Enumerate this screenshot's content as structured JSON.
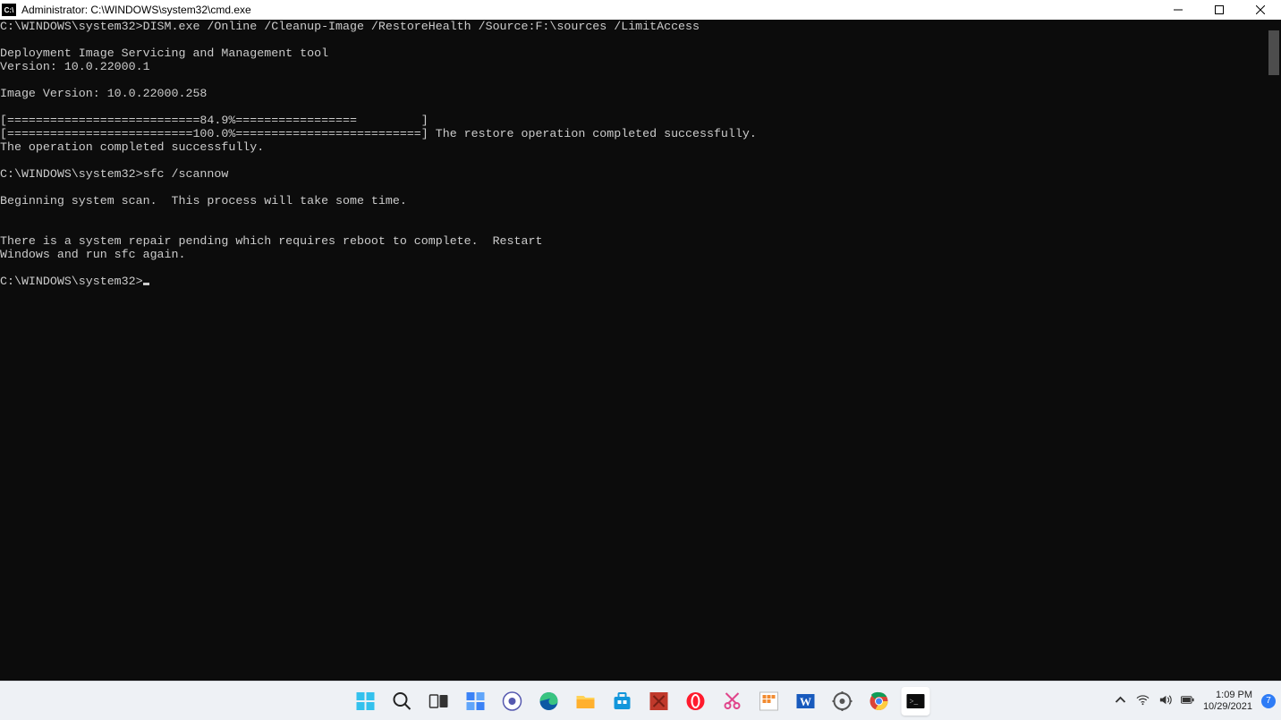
{
  "window": {
    "title": "Administrator: C:\\WINDOWS\\system32\\cmd.exe",
    "appicon_text": "C:\\"
  },
  "terminal": {
    "lines": [
      "C:\\WINDOWS\\system32>DISM.exe /Online /Cleanup-Image /RestoreHealth /Source:F:\\sources /LimitAccess",
      "",
      "Deployment Image Servicing and Management tool",
      "Version: 10.0.22000.1",
      "",
      "Image Version: 10.0.22000.258",
      "",
      "[===========================84.9%=================         ]",
      "[==========================100.0%==========================] The restore operation completed successfully.",
      "The operation completed successfully.",
      "",
      "C:\\WINDOWS\\system32>sfc /scannow",
      "",
      "Beginning system scan.  This process will take some time.",
      "",
      "",
      "There is a system repair pending which requires reboot to complete.  Restart",
      "Windows and run sfc again.",
      "",
      "C:\\WINDOWS\\system32>"
    ]
  },
  "taskbar": {
    "items": [
      {
        "name": "start",
        "label": "Start"
      },
      {
        "name": "search",
        "label": "Search"
      },
      {
        "name": "taskview",
        "label": "Task View"
      },
      {
        "name": "widgets",
        "label": "Widgets"
      },
      {
        "name": "chat",
        "label": "Chat"
      },
      {
        "name": "edge",
        "label": "Edge"
      },
      {
        "name": "explorer",
        "label": "File Explorer"
      },
      {
        "name": "store",
        "label": "Microsoft Store"
      },
      {
        "name": "app-red",
        "label": "App"
      },
      {
        "name": "opera",
        "label": "Opera"
      },
      {
        "name": "snip",
        "label": "Snip & Sketch"
      },
      {
        "name": "app-grid",
        "label": "App"
      },
      {
        "name": "word",
        "label": "Word"
      },
      {
        "name": "settings",
        "label": "Settings"
      },
      {
        "name": "chrome",
        "label": "Chrome"
      },
      {
        "name": "cmd",
        "label": "Command Prompt"
      }
    ]
  },
  "tray": {
    "time": "1:09 PM",
    "date": "10/29/2021",
    "notification_count": "7"
  }
}
